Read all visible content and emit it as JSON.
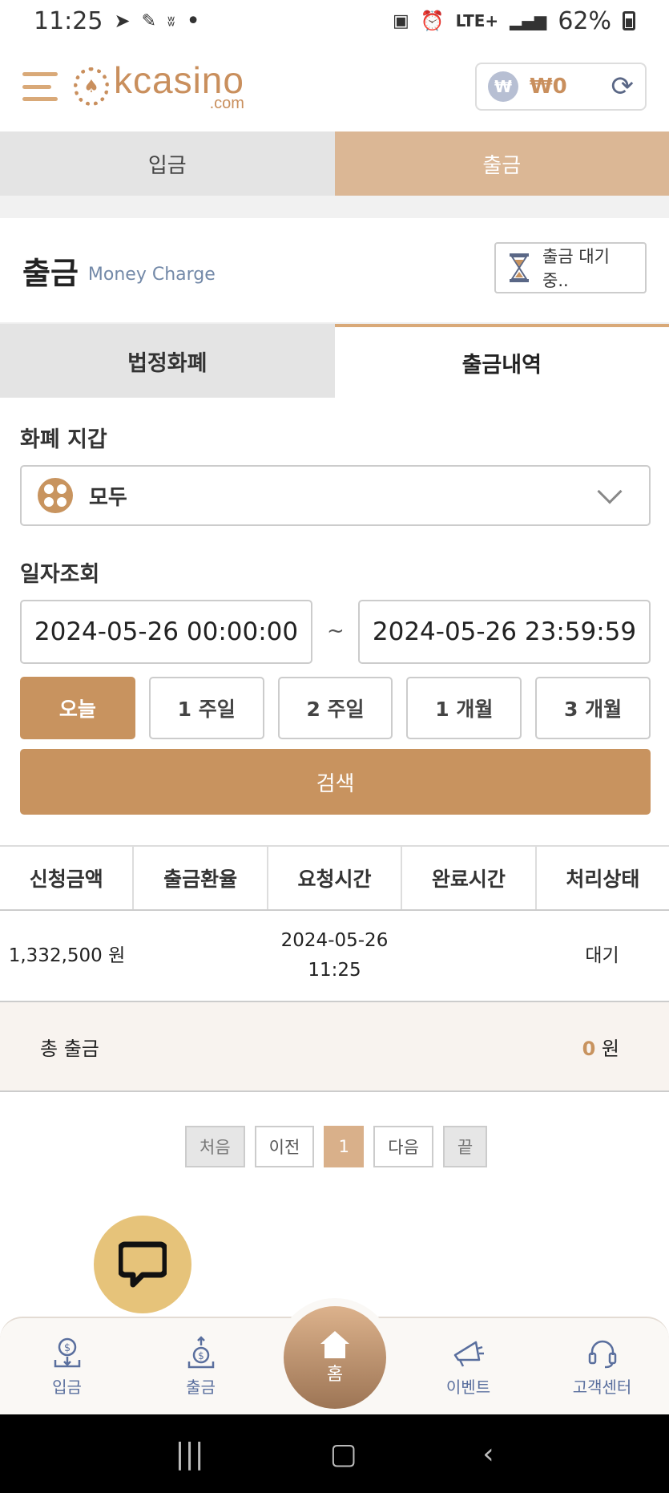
{
  "status_bar": {
    "time": "11:25",
    "indicators": "•",
    "network": "LTE+",
    "battery": "62%"
  },
  "header": {
    "logo_text": "kcasino",
    "logo_sub": ".com",
    "currency_symbol": "₩",
    "balance": "₩0"
  },
  "top_tabs": [
    {
      "label": "입금",
      "active": false
    },
    {
      "label": "출금",
      "active": true
    }
  ],
  "title": {
    "main": "출금",
    "sub": "Money Charge",
    "pending_label": "출금 대기 중.."
  },
  "sub_tabs": [
    {
      "label": "법정화폐",
      "active": false
    },
    {
      "label": "출금내역",
      "active": true
    }
  ],
  "wallet": {
    "label": "화폐 지갑",
    "selected": "모두"
  },
  "date_query": {
    "label": "일자조회",
    "start": "2024-05-26 00:00:00",
    "separator": "~",
    "end": "2024-05-26 23:59:59"
  },
  "periods": [
    {
      "label": "오늘",
      "active": true
    },
    {
      "label": "1 주일",
      "active": false
    },
    {
      "label": "2 주일",
      "active": false
    },
    {
      "label": "1 개월",
      "active": false
    },
    {
      "label": "3 개월",
      "active": false
    }
  ],
  "search_label": "검색",
  "table": {
    "headers": [
      "신청금액",
      "출금환율",
      "요청시간",
      "완료시간",
      "처리상태"
    ],
    "rows": [
      {
        "amount": "1,332,500 원",
        "rate": "",
        "request_date": "2024-05-26",
        "request_time": "11:25",
        "complete": "",
        "status": "대기"
      }
    ],
    "total_label": "총 출금",
    "total_value": "0",
    "total_unit": "원"
  },
  "pagination": {
    "first": "처음",
    "prev": "이전",
    "current": "1",
    "next": "다음",
    "last": "끝"
  },
  "bottom_nav": {
    "deposit": "입금",
    "withdraw": "출금",
    "home": "홈",
    "event": "이벤트",
    "support": "고객센터"
  },
  "colors": {
    "accent": "#c8935f",
    "tab_active": "#dbb795",
    "nav_text": "#5a6f9e",
    "chat": "#e6c37a"
  }
}
